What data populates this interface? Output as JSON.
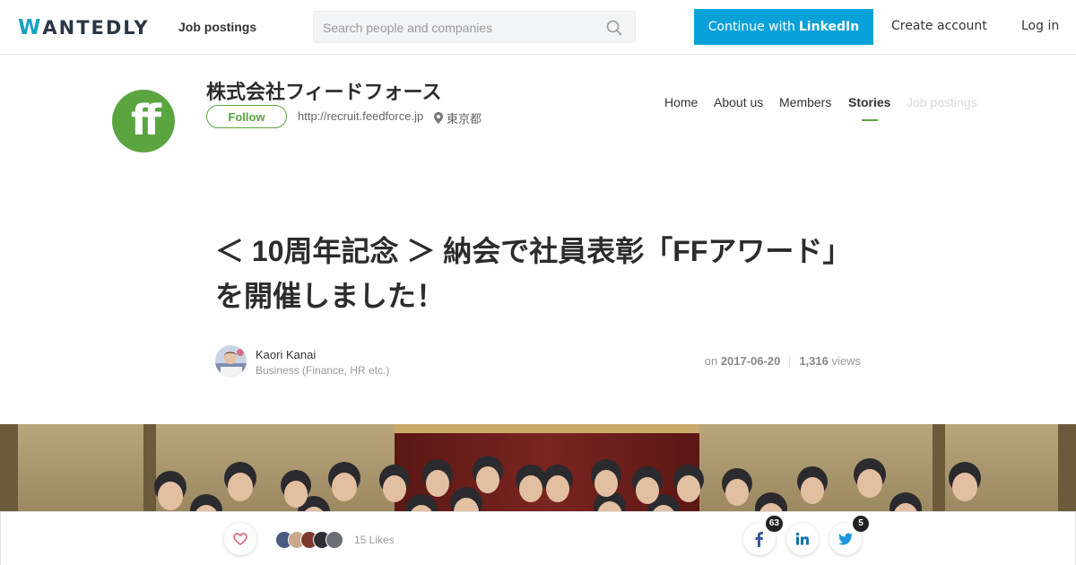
{
  "header": {
    "logo_text": "WANTEDLY",
    "job_postings": "Job postings",
    "search_placeholder": "Search people and companies",
    "linkedin_prefix": "Continue with",
    "linkedin_brand": "LinkedIn",
    "create_account": "Create account",
    "login": "Log in"
  },
  "company": {
    "name": "株式会社フィードフォース",
    "follow_label": "Follow",
    "url": "http://recruit.feedforce.jp",
    "location": "東京都",
    "tabs": [
      "Home",
      "About us",
      "Members",
      "Stories",
      "Job postings"
    ],
    "active_tab": "Stories"
  },
  "article": {
    "title": "＜ 10周年記念 ＞ 納会で社員表彰「FFアワード」を開催しました！",
    "author": {
      "name": "Kaori Kanai",
      "role": "Business (Finance, HR etc.)"
    },
    "date_prefix": "on",
    "date": "2017-06-20",
    "views": "1,316",
    "views_label": "views"
  },
  "footer": {
    "likes": "15 Likes",
    "facebook_count": "63",
    "twitter_count": "5"
  },
  "colors": {
    "brand_green": "#5ba541",
    "linkedin_blue": "#0aa1d8",
    "wantedly_blue": "#1aa2c4",
    "heart_red": "#e0506a"
  },
  "icons": {
    "search": "search-icon",
    "location": "map-pin-icon",
    "like": "heart-icon",
    "facebook": "facebook-icon",
    "linkedin": "linkedin-icon",
    "twitter": "twitter-icon"
  }
}
